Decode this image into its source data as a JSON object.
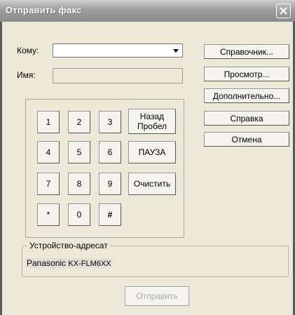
{
  "window": {
    "title": "Отправить факс"
  },
  "to_field": {
    "label": "Кому:",
    "value": ""
  },
  "name_field": {
    "label": "Имя:",
    "value": ""
  },
  "keypad": {
    "keys": [
      "1",
      "2",
      "3",
      "4",
      "5",
      "6",
      "7",
      "8",
      "9",
      "*",
      "0",
      "#"
    ],
    "backspace_line1": "Назад",
    "backspace_line2": "Пробел",
    "pause": "ПАУЗА",
    "clear": "Очистить"
  },
  "side_buttons": {
    "directory": "Справочник...",
    "preview": "Просмотр...",
    "advanced": "Дополнительно...",
    "help": "Справка",
    "cancel": "Отмена"
  },
  "device_group": {
    "title": "Устройство-адресат",
    "brand": "Panasonic",
    "model": "KX-FLM6XX"
  },
  "send_button": {
    "label": "Отправить",
    "enabled": false
  }
}
